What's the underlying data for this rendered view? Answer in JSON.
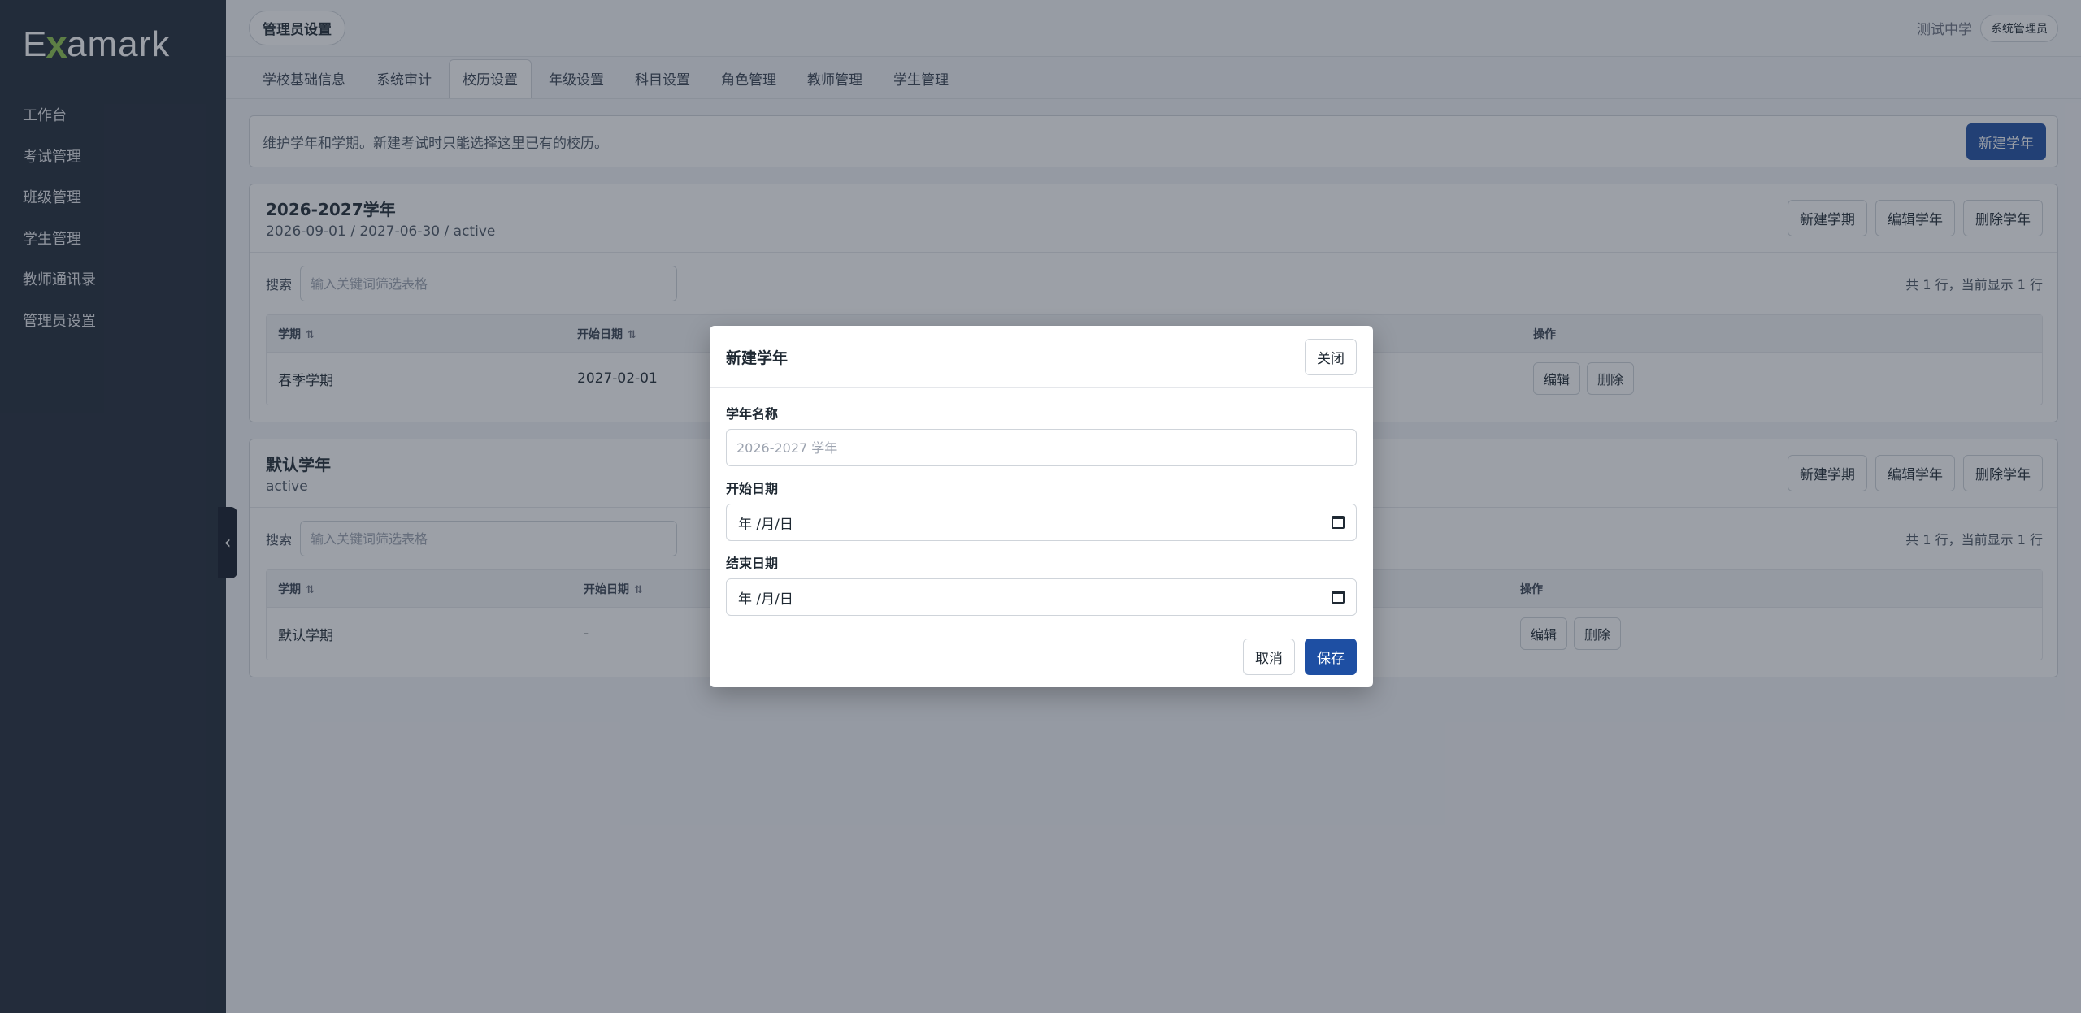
{
  "app": {
    "logo_text_pre": "E",
    "logo_text_x": "x",
    "logo_text_post": "amark"
  },
  "sidebar": {
    "items": [
      {
        "label": "工作台"
      },
      {
        "label": "考试管理"
      },
      {
        "label": "班级管理"
      },
      {
        "label": "学生管理"
      },
      {
        "label": "教师通讯录"
      },
      {
        "label": "管理员设置"
      }
    ],
    "collapse_icon": "‹"
  },
  "topbar": {
    "page_title": "管理员设置",
    "school_name": "测试中学",
    "user_role": "系统管理员"
  },
  "tabs": [
    {
      "label": "学校基础信息"
    },
    {
      "label": "系统审计"
    },
    {
      "label": "校历设置"
    },
    {
      "label": "年级设置"
    },
    {
      "label": "科目设置"
    },
    {
      "label": "角色管理"
    },
    {
      "label": "教师管理"
    },
    {
      "label": "学生管理"
    }
  ],
  "active_tab": "校历设置",
  "info": {
    "text": "维护学年和学期。新建考试时只能选择这里已有的校历。",
    "new_year_button": "新建学年"
  },
  "years": [
    {
      "title": "2026-2027学年",
      "subtitle": "2026-09-01 / 2027-06-30 / active",
      "buttons": {
        "new_term": "新建学期",
        "edit_year": "编辑学年",
        "delete_year": "删除学年"
      },
      "search_label": "搜索",
      "search_placeholder": "输入关键词筛选表格",
      "row_count": "共 1 行，当前显示 1 行",
      "columns": {
        "term": "学期",
        "start": "开始日期",
        "actions": "操作"
      },
      "rows": [
        {
          "term": "春季学期",
          "start": "2027-02-01",
          "edit": "编辑",
          "delete": "删除"
        }
      ]
    },
    {
      "title": "默认学年",
      "subtitle": "active",
      "buttons": {
        "new_term": "新建学期",
        "edit_year": "编辑学年",
        "delete_year": "删除学年"
      },
      "search_label": "搜索",
      "search_placeholder": "输入关键词筛选表格",
      "row_count": "共 1 行，当前显示 1 行",
      "columns": {
        "term": "学期",
        "start": "开始日期",
        "actions": "操作"
      },
      "rows": [
        {
          "term": "默认学期",
          "start": "-",
          "edit": "编辑",
          "delete": "删除"
        }
      ]
    }
  ],
  "modal": {
    "title": "新建学年",
    "close_button": "关闭",
    "name_label": "学年名称",
    "name_placeholder": "2026-2027 学年",
    "start_label": "开始日期",
    "start_value": "年 /月/日",
    "end_label": "结束日期",
    "end_value": "年 /月/日",
    "cancel_button": "取消",
    "save_button": "保存"
  },
  "colors": {
    "sidebar_bg": "#1f2937",
    "primary": "#1e4fa3",
    "logo_accent": "#8bc34a"
  }
}
